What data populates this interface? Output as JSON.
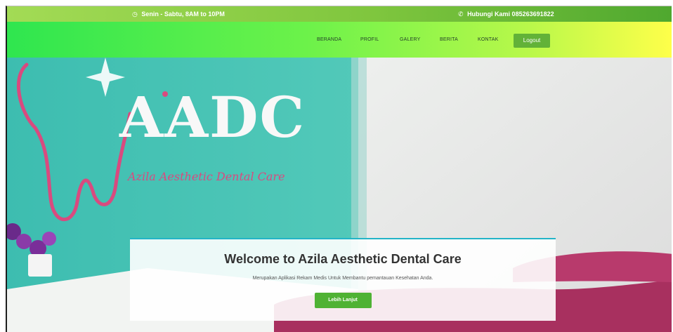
{
  "topbar": {
    "hours_icon": "clock-icon",
    "hours": "Senin - Sabtu, 8AM to 10PM",
    "phone_icon": "phone-icon",
    "phone": "Hubungi Kami 085263691822"
  },
  "nav": {
    "items": [
      {
        "label": "BERANDA"
      },
      {
        "label": "PROFIL"
      },
      {
        "label": "GALERY"
      },
      {
        "label": "BERITA"
      },
      {
        "label": "KONTAK"
      }
    ],
    "logout_label": "Logout"
  },
  "hero": {
    "logo_text": "AADC",
    "logo_subtitle": "Azila Aesthetic Dental Care",
    "title": "Welcome to Azila Aesthetic Dental Care",
    "subtitle": "Merupakan Aplikasi Rekam Medis Untuk Membantu pemantauan Kesehatan Anda.",
    "cta_label": "Lebih Lanjut"
  },
  "colors": {
    "topbar": "#7fc63e",
    "nav_start": "#2fe64f",
    "nav_end": "#ffff4a",
    "button": "#4fb234",
    "card_border": "#23b4c7",
    "wall": "#3fc1b0"
  }
}
